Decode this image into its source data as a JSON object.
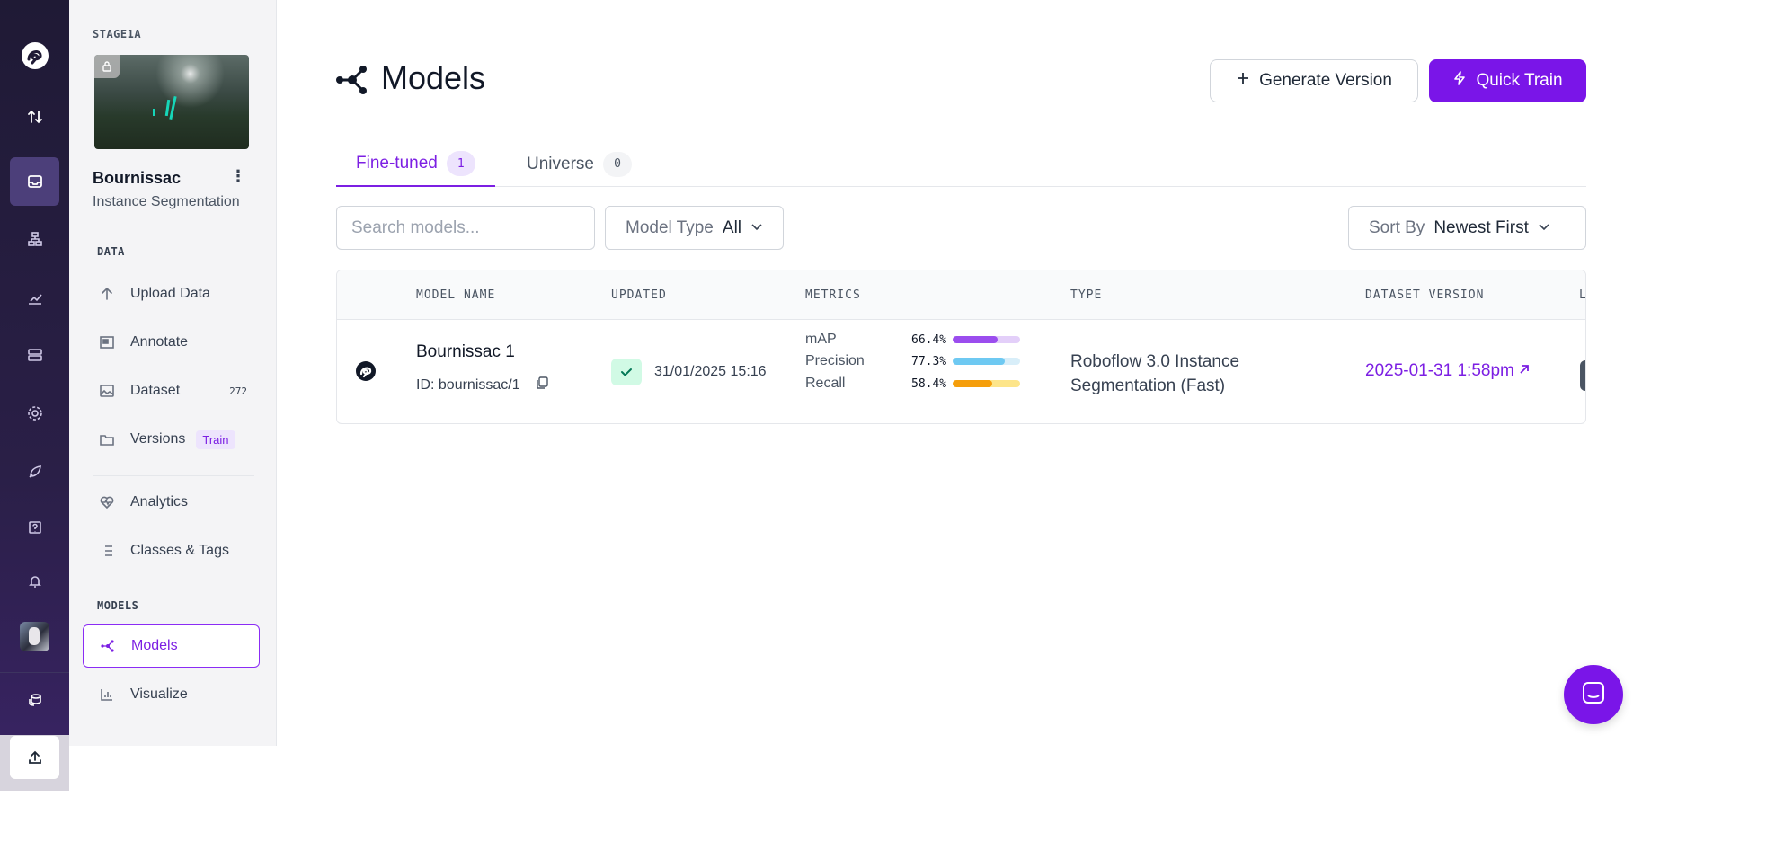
{
  "rail": {
    "icons": [
      "roboflow-logo-icon",
      "transfer-arrows-icon",
      "inbox-icon",
      "workflow-icon",
      "chart-icon",
      "server-icon",
      "settings-gear-icon",
      "rocket-icon",
      "help-icon",
      "bell-icon",
      "stack-icon",
      "upload-icon"
    ]
  },
  "sidebar": {
    "workspace": "STAGE1A",
    "project_name": "Bournissac",
    "project_type": "Instance Segmentation",
    "section_data": "DATA",
    "section_models": "MODELS",
    "items": [
      {
        "label": "Upload Data",
        "icon": "arrow-up-icon"
      },
      {
        "label": "Annotate",
        "icon": "annotate-icon"
      },
      {
        "label": "Dataset",
        "icon": "image-icon",
        "count": "272"
      },
      {
        "label": "Versions",
        "icon": "folders-icon",
        "pill": "Train"
      },
      {
        "label": "Analytics",
        "icon": "heart-pulse-icon"
      },
      {
        "label": "Classes & Tags",
        "icon": "list-icon"
      },
      {
        "label": "Models",
        "icon": "models-icon"
      },
      {
        "label": "Visualize",
        "icon": "bar-chart-icon"
      }
    ]
  },
  "header": {
    "title": "Models",
    "generate_label": "Generate Version",
    "quick_train_label": "Quick Train"
  },
  "tabs": [
    {
      "label": "Fine-tuned",
      "count": "1"
    },
    {
      "label": "Universe",
      "count": "0"
    }
  ],
  "filters": {
    "search_placeholder": "Search models...",
    "model_type_label": "Model Type",
    "model_type_value": "All",
    "sort_label": "Sort By",
    "sort_value": "Newest First"
  },
  "table": {
    "columns": [
      "MODEL NAME",
      "UPDATED",
      "METRICS",
      "TYPE",
      "DATASET VERSION",
      "L"
    ],
    "rows": [
      {
        "name": "Bournissac 1",
        "id": "ID: bournissac/1",
        "updated": "31/01/2025 15:16",
        "metrics": [
          {
            "label": "mAP",
            "value": "66.4%",
            "fraction": 0.664,
            "color": "#9b4dee",
            "track": "#e3cff9"
          },
          {
            "label": "Precision",
            "value": "77.3%",
            "fraction": 0.773,
            "color": "#6ec9f2",
            "track": "#d8eef9"
          },
          {
            "label": "Recall",
            "value": "58.4%",
            "fraction": 0.584,
            "color": "#f59e0b",
            "track": "#fde58a"
          }
        ],
        "type": "Roboflow 3.0 Instance Segmentation (Fast)",
        "dataset_version": "2025-01-31 1:58pm"
      }
    ]
  },
  "colors": {
    "accent": "#7a15e8",
    "rail_bg": "#231c3d"
  }
}
